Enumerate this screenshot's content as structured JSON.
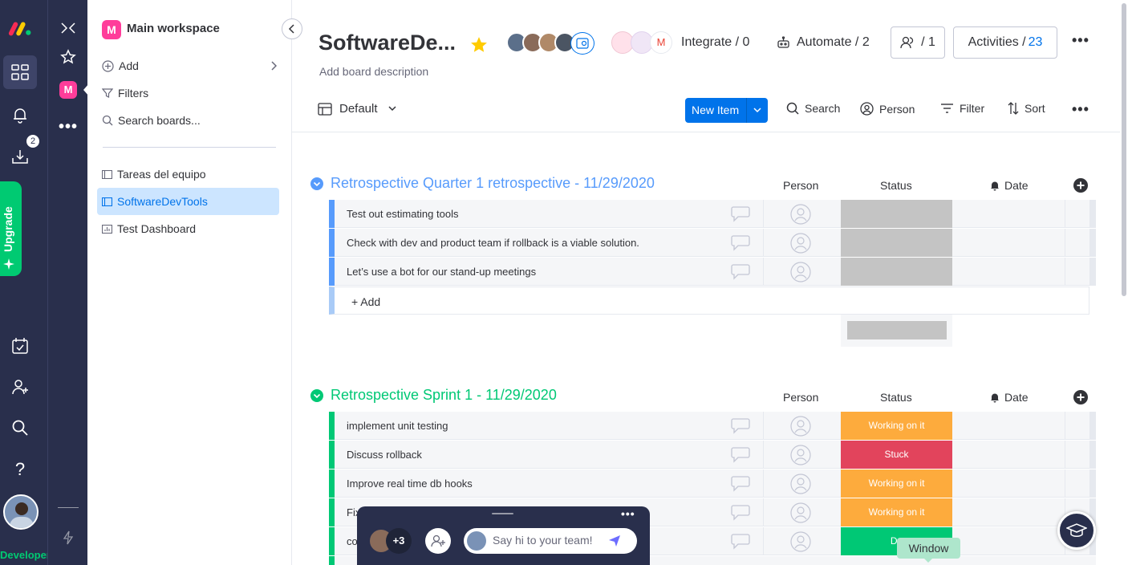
{
  "rail": {
    "upgrade_label": "Upgrade",
    "notifications_badge": "2",
    "developer_label": "Developer"
  },
  "workspace": {
    "name": "Main workspace",
    "avatar_letter": "M",
    "add_label": "Add",
    "filters_label": "Filters",
    "search_label": "Search boards...",
    "boards": [
      {
        "label": "Tareas del equipo"
      },
      {
        "label": "SoftwareDevTools"
      },
      {
        "label": "Test Dashboard"
      }
    ]
  },
  "board": {
    "title": "SoftwareDe...",
    "description": "Add board description",
    "integrate_label": "Integrate / 0",
    "automate_label": "Automate / 2",
    "members_count": "/ 1",
    "activities_label": "Activities /",
    "activities_count": "23"
  },
  "toolbar": {
    "view_label": "Default",
    "new_item_label": "New Item",
    "search_label": "Search",
    "person_label": "Person",
    "filter_label": "Filter",
    "sort_label": "Sort"
  },
  "groups": [
    {
      "title": "Retrospective Quarter 1 retrospective - 11/29/2020",
      "color": "#579bfc",
      "columns": {
        "person": "Person",
        "status": "Status",
        "date": "Date"
      },
      "rows": [
        {
          "name": "Test out estimating tools",
          "status": "",
          "status_color": "#c4c4c4"
        },
        {
          "name": "Check with dev and product team if rollback is a viable solution.",
          "status": "",
          "status_color": "#c4c4c4"
        },
        {
          "name": "Let’s use a bot for our stand-up meetings",
          "status": "",
          "status_color": "#c4c4c4"
        }
      ],
      "add_label": "+ Add"
    },
    {
      "title": "Retrospective Sprint 1 - 11/29/2020",
      "color": "#00c875",
      "columns": {
        "person": "Person",
        "status": "Status",
        "date": "Date"
      },
      "rows": [
        {
          "name": "implement unit testing",
          "status": "Working on it",
          "status_color": "#fdab3d"
        },
        {
          "name": "Discuss rollback",
          "status": "Stuck",
          "status_color": "#e2445c"
        },
        {
          "name": "Improve real time db hooks",
          "status": "Working on it",
          "status_color": "#fdab3d"
        },
        {
          "name": "Fix",
          "status": "Working on it",
          "status_color": "#fdab3d"
        },
        {
          "name": "co",
          "status": "Do",
          "status_color": "#00c875"
        }
      ]
    }
  ],
  "chat": {
    "extra_count": "+3",
    "placeholder": "Say hi to your team!"
  },
  "tooltip": "Window",
  "colors": {
    "accent": "#0073ea",
    "rail": "#292f4c",
    "upgrade": "#00ca72"
  }
}
